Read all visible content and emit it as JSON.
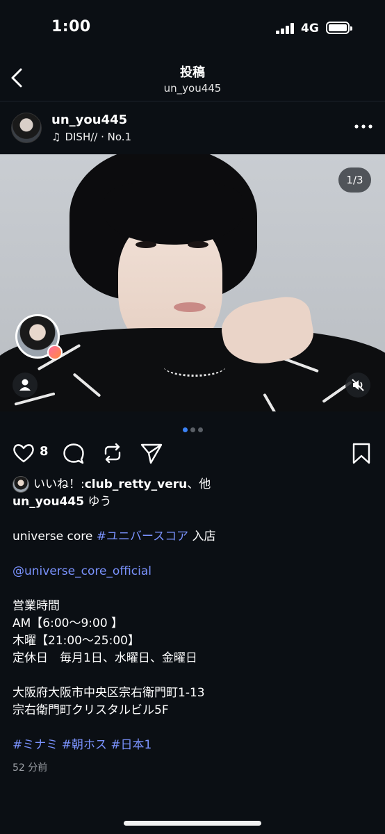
{
  "status_bar": {
    "time": "1:00",
    "network": "4G"
  },
  "header": {
    "title": "投稿",
    "subtitle": "un_you445"
  },
  "post": {
    "username": "un_you445",
    "music": "DISH// · No.1",
    "image_counter": "1/3",
    "carousel": {
      "count": 3,
      "active_index": 0
    },
    "like_count": "8",
    "liked_by_prefix": "いいね！: ",
    "liked_by_user": "club_retty_veru",
    "liked_by_suffix": "、他",
    "caption_user": "un_you445",
    "caption_first": " ゆう",
    "caption_lines": {
      "l1_text": "universe core ",
      "l1_tag": "#ユニバースコア",
      "l1_suffix": " 入店",
      "l2_mention": "@universe_core_official",
      "l3": "営業時間",
      "l4": "AM【6:00～9:00 】",
      "l5": "木曜【21:00～25:00】",
      "l6": "定休日　毎月1日、水曜日、金曜日",
      "l7": "大阪府大阪市中央区宗右衛門町1-13",
      "l8": "宗右衛門町クリスタルビル5F",
      "tag1": "#ミナミ",
      "tag2": "#朝ホス",
      "tag3": "#日本1"
    },
    "timestamp": "52 分前"
  },
  "icons": {
    "back": "chevron-left-icon",
    "more": "more-horizontal-icon",
    "music": "music-note-icon",
    "like": "heart-icon",
    "comment": "comment-icon",
    "repost": "repost-icon",
    "share": "send-icon",
    "save": "bookmark-icon",
    "tagged": "person-icon",
    "mute": "speaker-muted-icon"
  },
  "colors": {
    "background": "#0b0f14",
    "link": "#7b93ff",
    "active_dot": "#3b82f6"
  }
}
